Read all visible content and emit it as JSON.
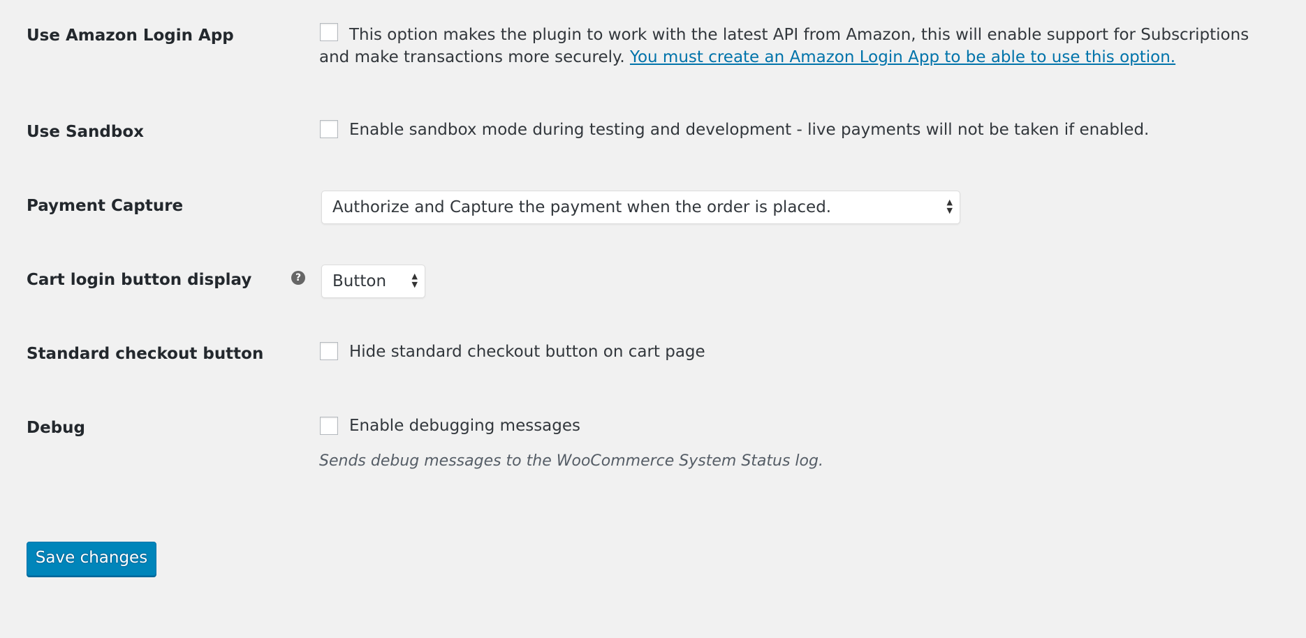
{
  "settings": {
    "amazon_login_app": {
      "label": "Use Amazon Login App",
      "checked": false,
      "description": "This option makes the plugin to work with the latest API from Amazon, this will enable support for Subscriptions and make transactions more securely. ",
      "link": "You must create an Amazon Login App to be able to use this option."
    },
    "sandbox": {
      "label": "Use Sandbox",
      "checked": false,
      "description": "Enable sandbox mode during testing and development - live payments will not be taken if enabled."
    },
    "payment_capture": {
      "label": "Payment Capture",
      "selected": "Authorize and Capture the payment when the order is placed."
    },
    "cart_login_button": {
      "label": "Cart login button display",
      "help_icon": "question-circle-icon",
      "help_glyph": "?",
      "selected": "Button"
    },
    "standard_checkout": {
      "label": "Standard checkout button",
      "checked": false,
      "description": "Hide standard checkout button on cart page"
    },
    "debug": {
      "label": "Debug",
      "checked": false,
      "description": "Enable debugging messages",
      "note": "Sends debug messages to the WooCommerce System Status log."
    }
  },
  "save_label": "Save changes",
  "colors": {
    "primary_button": "#0085ba",
    "link": "#0073aa",
    "background": "#f1f1f1"
  }
}
